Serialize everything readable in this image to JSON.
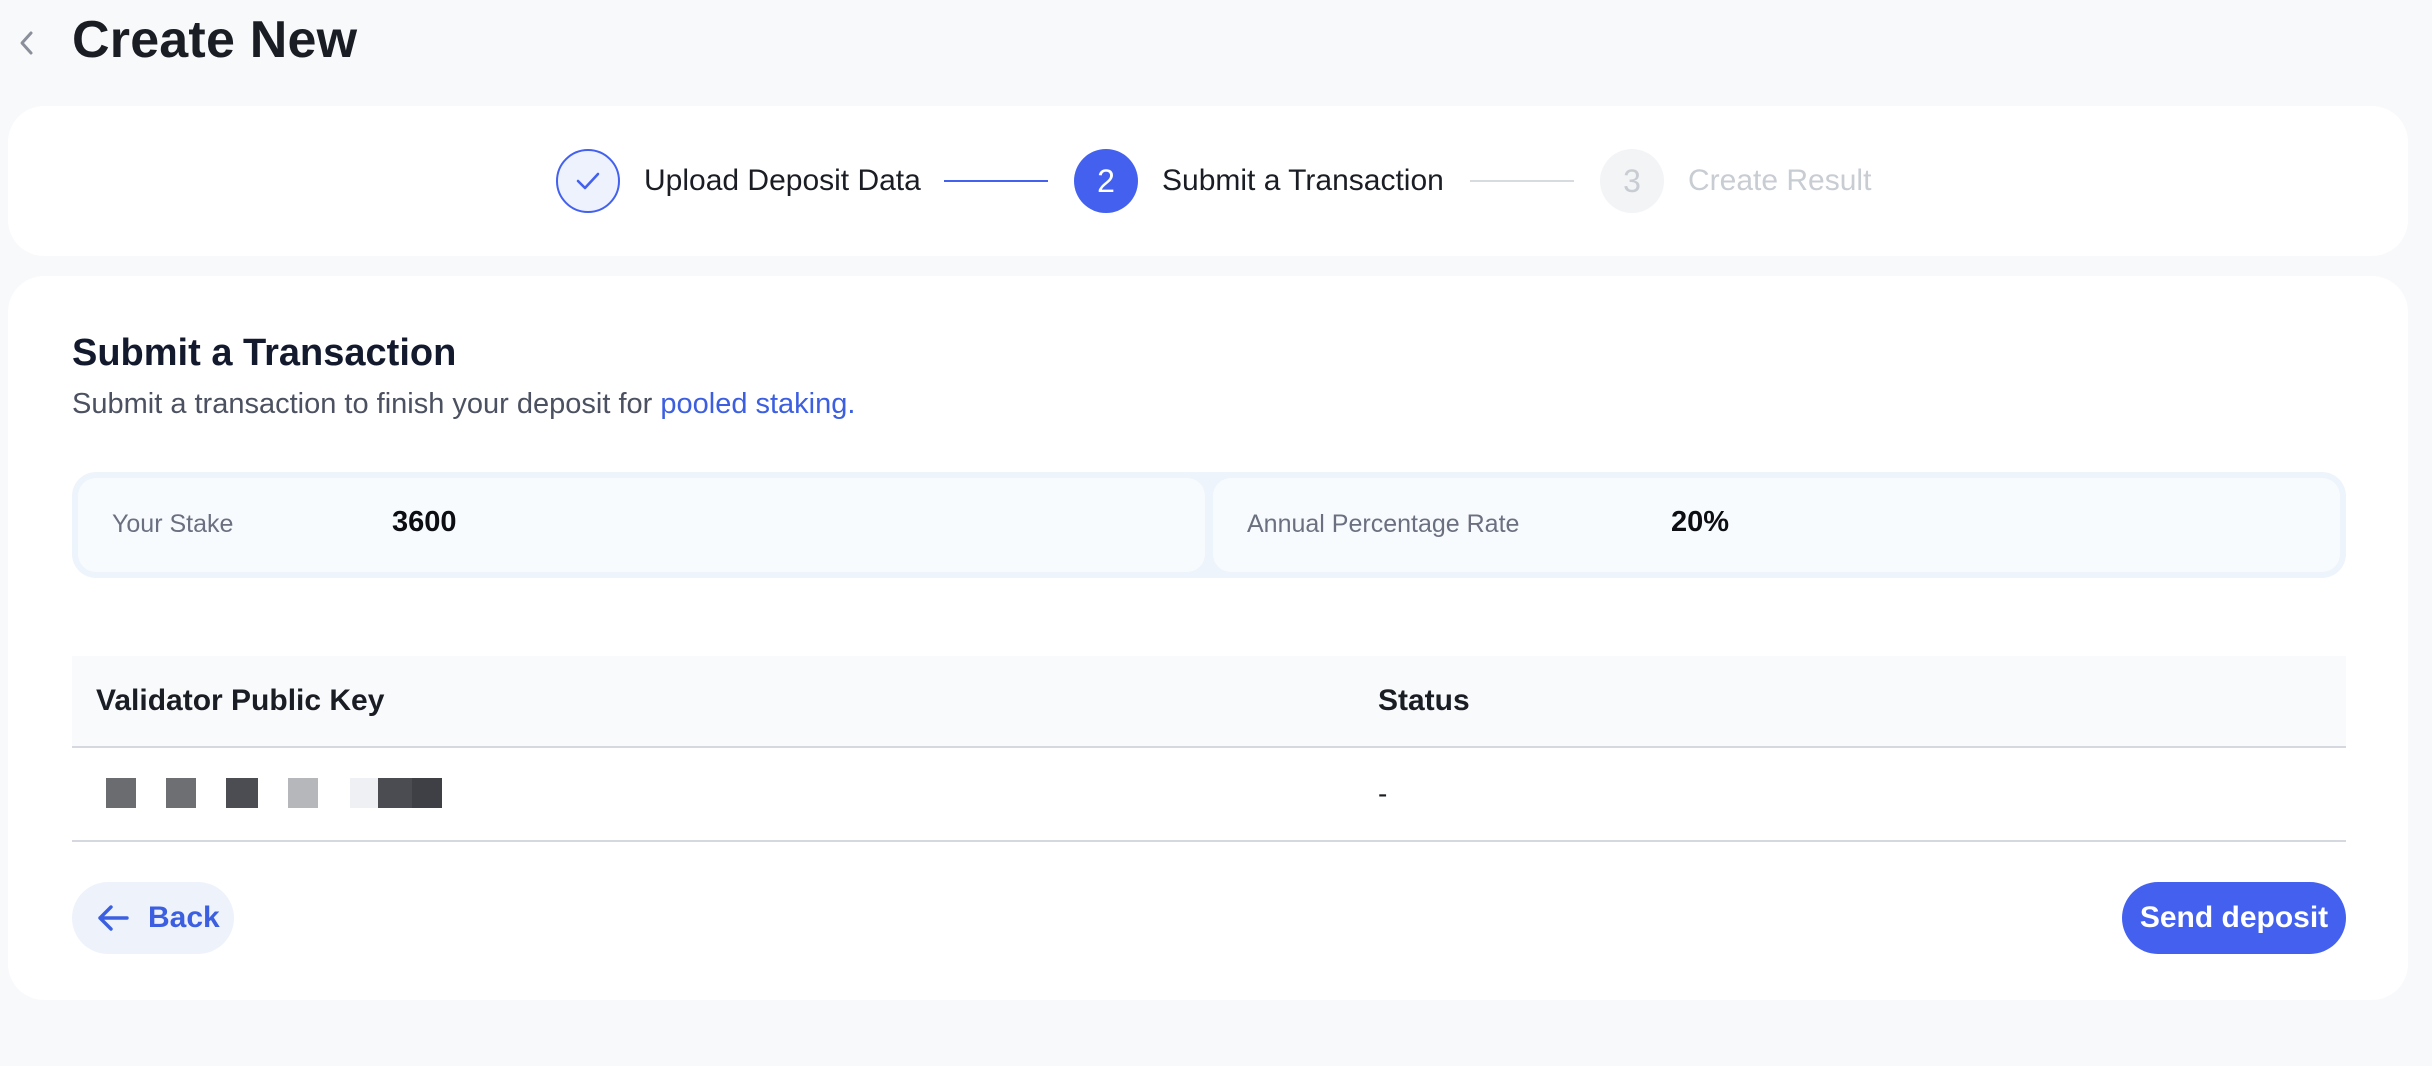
{
  "header": {
    "title": "Create New",
    "back_icon": "chevron-left-icon"
  },
  "stepper": {
    "steps": [
      {
        "number": "1",
        "label": "Upload Deposit Data",
        "state": "completed",
        "icon": "check-icon"
      },
      {
        "number": "2",
        "label": "Submit a Transaction",
        "state": "active"
      },
      {
        "number": "3",
        "label": "Create Result",
        "state": "pending"
      }
    ]
  },
  "main": {
    "title": "Submit a Transaction",
    "subtitle_prefix": "Submit a transaction to finish your deposit for ",
    "subtitle_link": "pooled staking."
  },
  "info": {
    "stake_label": "Your Stake",
    "stake_value": "3600",
    "apr_label": "Annual Percentage Rate",
    "apr_value": "20%"
  },
  "table": {
    "columns": [
      "Validator Public Key",
      "Status"
    ],
    "rows": [
      {
        "public_key": "",
        "status": "-"
      }
    ]
  },
  "actions": {
    "back_label": "Back",
    "back_icon": "arrow-left-icon",
    "send_label": "Send deposit"
  },
  "colors": {
    "accent": "#4361ee",
    "link": "#3b5fe0",
    "background": "#f8f9fb"
  }
}
